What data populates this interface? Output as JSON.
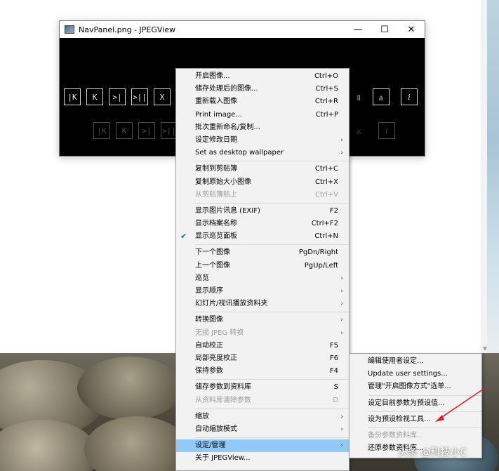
{
  "window": {
    "title": "NavPanel.png - JPEGView",
    "minimize_glyph": "—",
    "maximize_glyph": "☐",
    "close_glyph": "✕",
    "nav_buttons": [
      "|K",
      "K",
      ">|",
      ">||",
      "X"
    ],
    "nav_buttons_right": [
      "▯",
      "◬",
      "i"
    ]
  },
  "menu": {
    "groups": [
      [
        {
          "label": "开启图像...",
          "shortcut": "Ctrl+O"
        },
        {
          "label": "储存处理后的图像...",
          "shortcut": "Ctrl+S"
        },
        {
          "label": "重新载入图像",
          "shortcut": "Ctrl+R"
        },
        {
          "label": "Print image...",
          "shortcut": "Ctrl+P"
        },
        {
          "label": "批次重新命名/复制...",
          "shortcut": ""
        },
        {
          "label": "设定修改日期",
          "shortcut": "",
          "submenu": true
        },
        {
          "label": "Set as desktop wallpaper",
          "shortcut": "",
          "submenu": true
        }
      ],
      [
        {
          "label": "复制到剪贴簿",
          "shortcut": "Ctrl+C"
        },
        {
          "label": "复制原始大小图像",
          "shortcut": "Ctrl+X"
        },
        {
          "label": "从剪贴簿贴上",
          "shortcut": "Ctrl+V",
          "disabled": true
        }
      ],
      [
        {
          "label": "显示图片讯息 (EXIF)",
          "shortcut": "F2"
        },
        {
          "label": "显示档案名称",
          "shortcut": "Ctrl+F2"
        },
        {
          "label": "显示巡览面板",
          "shortcut": "Ctrl+N",
          "checked": true
        }
      ],
      [
        {
          "label": "下一个图像",
          "shortcut": "PgDn/Right"
        },
        {
          "label": "上一个图像",
          "shortcut": "PgUp/Left"
        },
        {
          "label": "巡览",
          "shortcut": "",
          "submenu": true
        },
        {
          "label": "显示顺序",
          "shortcut": "",
          "submenu": true
        },
        {
          "label": "幻灯片/视讯播放资料夹",
          "shortcut": "",
          "submenu": true
        }
      ],
      [
        {
          "label": "转换图像",
          "shortcut": "",
          "submenu": true
        },
        {
          "label": "无损 JPEG 转换",
          "shortcut": "",
          "submenu": true,
          "disabled": true
        },
        {
          "label": "自动校正",
          "shortcut": "F5"
        },
        {
          "label": "局部亮度校正",
          "shortcut": "F6"
        },
        {
          "label": "保持参数",
          "shortcut": "F4"
        }
      ],
      [
        {
          "label": "储存参数到资料库",
          "shortcut": "S"
        },
        {
          "label": "从资料库清除参数",
          "shortcut": "D",
          "disabled": true
        }
      ],
      [
        {
          "label": "缩放",
          "shortcut": "",
          "submenu": true
        },
        {
          "label": "自动缩放模式",
          "shortcut": "",
          "submenu": true
        }
      ],
      [
        {
          "label": "设定/管理",
          "shortcut": "",
          "submenu": true,
          "highlighted": true
        },
        {
          "label": "关于 JPEGView...",
          "shortcut": ""
        }
      ]
    ]
  },
  "submenu": {
    "groups": [
      [
        {
          "label": "编辑使用者设定..."
        },
        {
          "label": "Update user settings..."
        },
        {
          "label": "管理\"开启图像方式\"选单..."
        }
      ],
      [
        {
          "label": "设定目前参数为预设值..."
        }
      ],
      [
        {
          "label": "设为预设检视工具..."
        }
      ],
      [
        {
          "label": "备份参数资料库...",
          "disabled": true
        },
        {
          "label": "还原参数资料库..."
        }
      ]
    ]
  },
  "watermark": "头条 @科技小C",
  "colors": {
    "menu_bg": "#f2f2f2",
    "highlight": "#91c9f7",
    "annotation_arrow": "#e02020"
  }
}
